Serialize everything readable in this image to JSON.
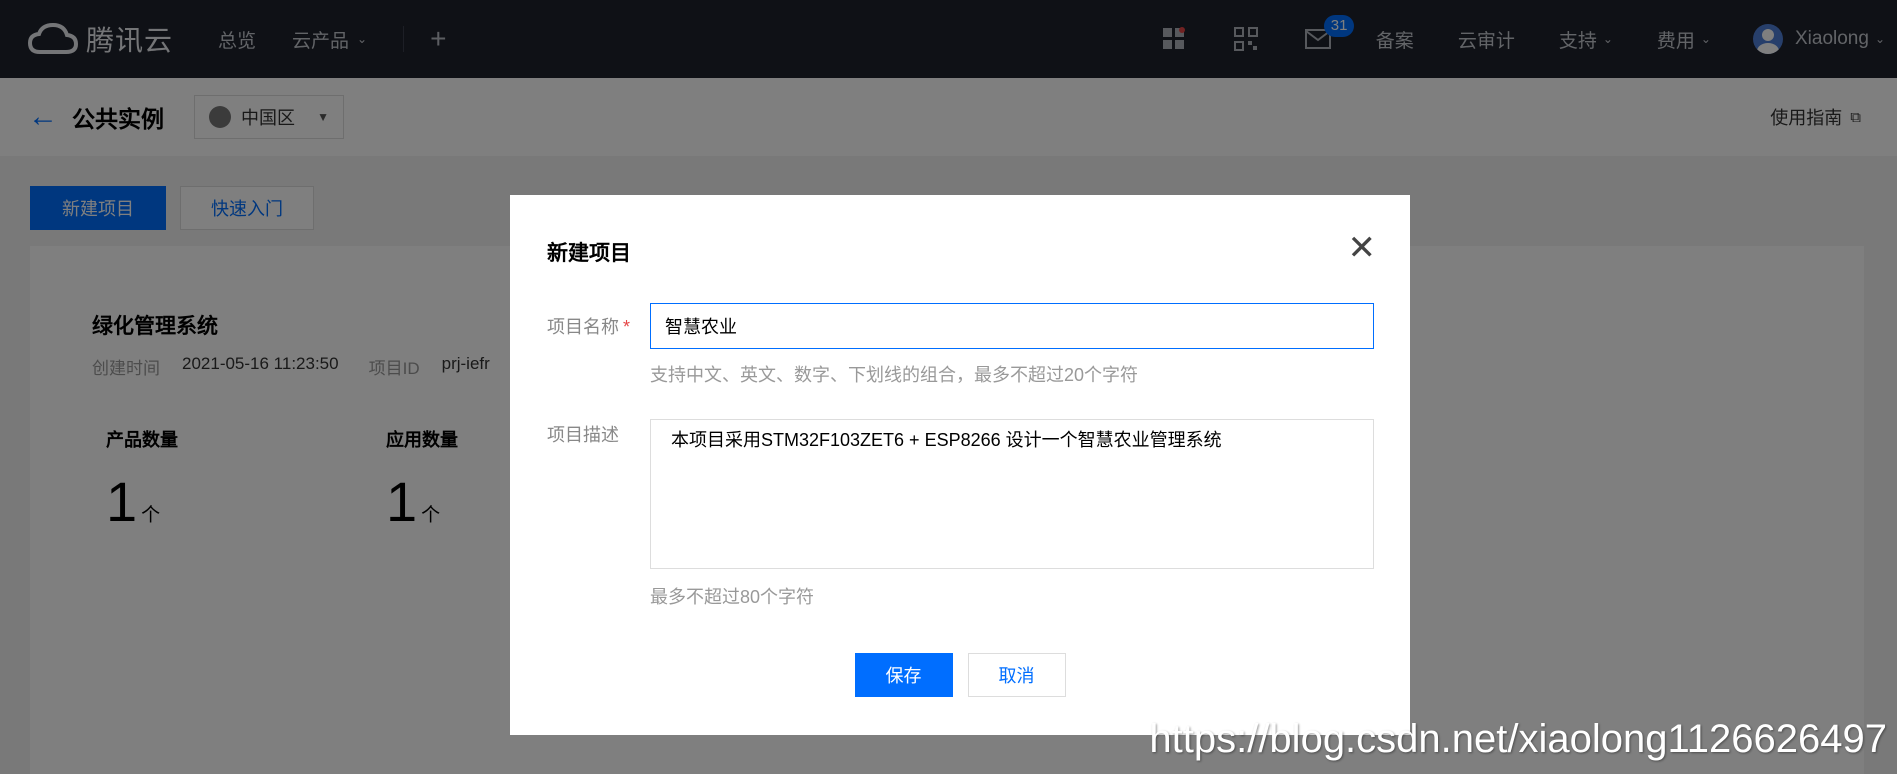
{
  "topnav": {
    "brand": "腾讯云",
    "overview": "总览",
    "products": "云产品",
    "plus": "+",
    "mail_badge": "31",
    "filing": "备案",
    "audit": "云审计",
    "support": "支持",
    "billing": "费用",
    "user": "Xiaolong",
    "chevron": "⌄"
  },
  "header": {
    "back": "←",
    "title": "公共实例",
    "region": "中国区",
    "guide": "使用指南",
    "guide_icon": "⧉"
  },
  "actions": {
    "new_project": "新建项目",
    "quick_start": "快速入门"
  },
  "card": {
    "title": "绿化管理系统",
    "created_label": "创建时间",
    "created_value": "2021-05-16 11:23:50",
    "id_label": "项目ID",
    "id_value": "prj-iefr",
    "stats": [
      {
        "label": "产品数量",
        "value": "1",
        "unit": "个"
      },
      {
        "label": "应用数量",
        "value": "1",
        "unit": "个"
      }
    ]
  },
  "dialog": {
    "title": "新建项目",
    "close": "✕",
    "name_label": "项目名称",
    "required": "*",
    "name_value": "智慧农业",
    "name_hint": "支持中文、英文、数字、下划线的组合，最多不超过20个字符",
    "desc_label": "项目描述",
    "desc_value": "本项目采用STM32F103ZET6 + ESP8266 设计一个智慧农业管理系统",
    "desc_hint": "最多不超过80个字符",
    "save": "保存",
    "cancel": "取消"
  },
  "watermark": "https://blog.csdn.net/xiaolong1126626497",
  "colors": {
    "primary": "#006eff",
    "nav_bg": "#1e222d",
    "required": "#e54545"
  }
}
